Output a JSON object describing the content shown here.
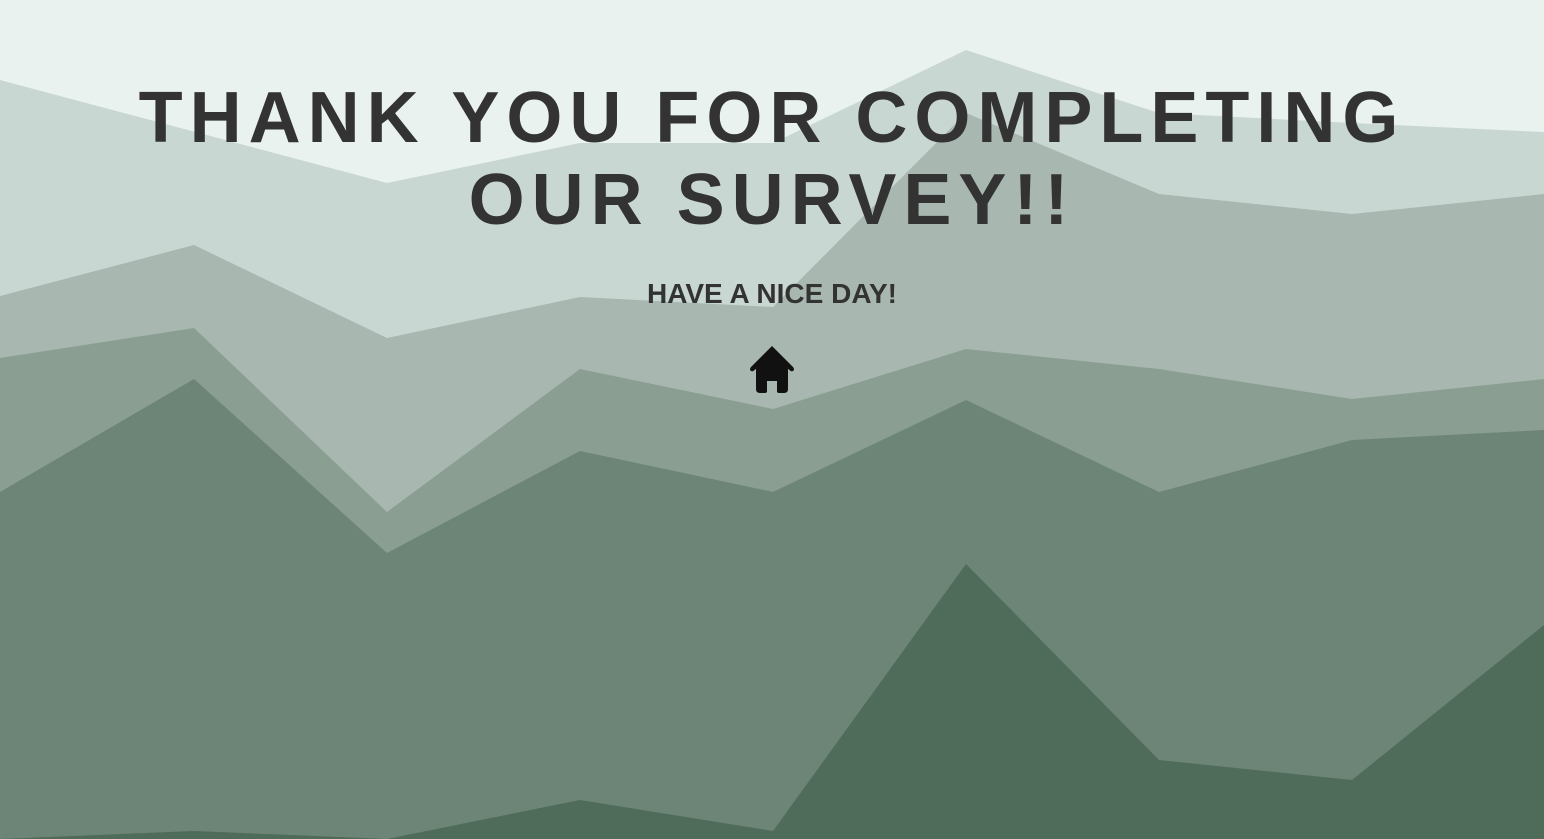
{
  "page": {
    "headline": "THANK YOU FOR COMPLETING OUR SURVEY!!",
    "subheadline": "HAVE A NICE DAY!"
  },
  "home_link": {
    "icon": "home-icon",
    "color": "#111111"
  },
  "colors": {
    "sky": "#eaf2f0",
    "layer_1": "#c9d7d3",
    "layer_2": "#a8b8b0",
    "layer_3": "#8a9e92",
    "layer_4": "#6d8576",
    "layer_5": "#4f6b59",
    "text": "#333333"
  }
}
